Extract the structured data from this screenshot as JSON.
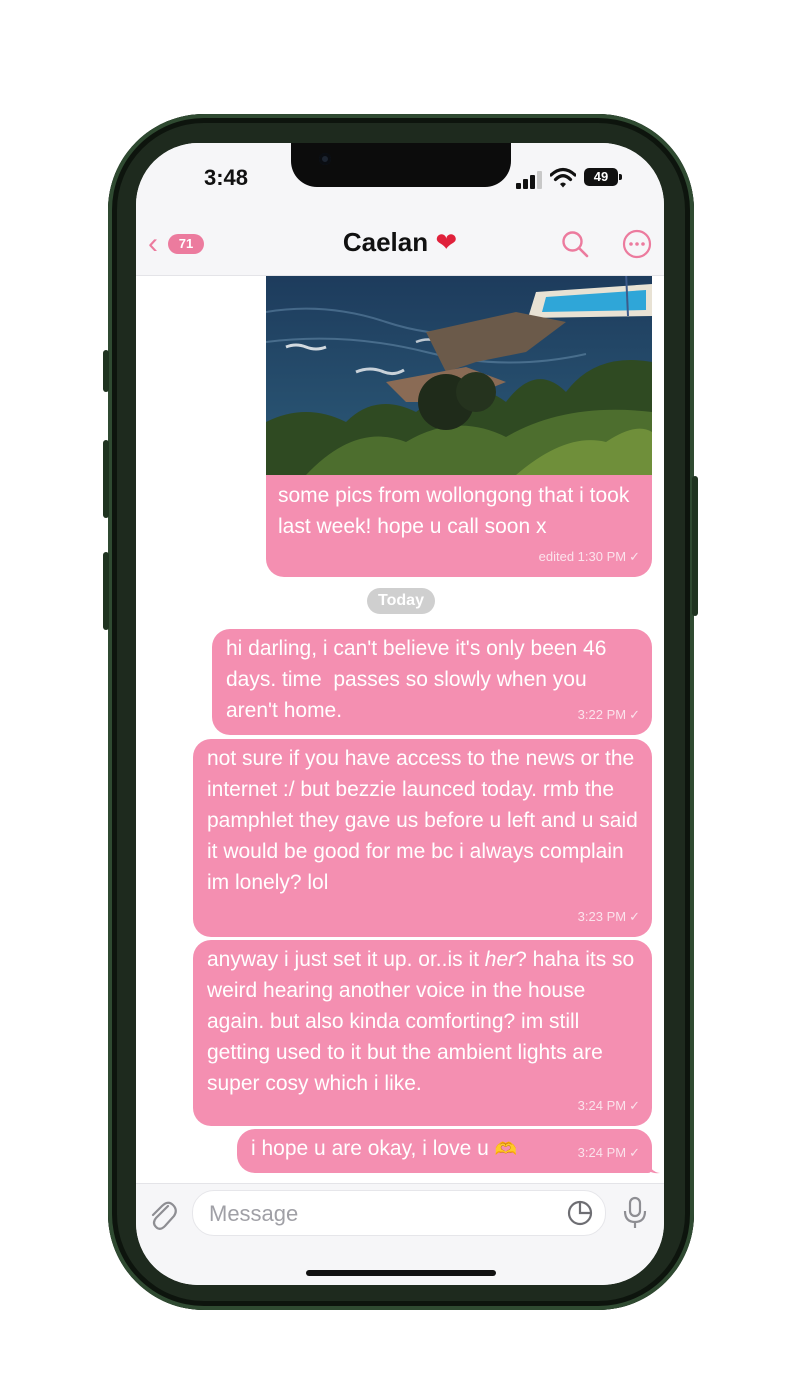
{
  "status_bar": {
    "time": "3:48",
    "battery": "49"
  },
  "header": {
    "back_count": "71",
    "contact_name": "Caelan",
    "name_emoji": "❤"
  },
  "messages": [
    {
      "type": "photo",
      "caption": "some pics from wollongong that i took last week! hope u call soon x",
      "meta": "edited 1:30 PM"
    },
    {
      "type": "date_separator",
      "label": "Today"
    },
    {
      "type": "text",
      "text": "hi darling, i can't believe it's only been 46 days. time  passes so slowly when you aren't home.",
      "time": "3:22 PM"
    },
    {
      "type": "text",
      "text": "not sure if you have access to the news or the internet :/ but bezzie launced today. rmb the pamphlet they gave us before u left and u said it would be good for me bc i always complain im lonely? lol",
      "time": "3:23 PM"
    },
    {
      "type": "text",
      "text_before": "anyway i just set it up. or..is it ",
      "text_italic": "her",
      "text_after": "? haha its so weird hearing another voice in the house again. but also kinda comforting? im still getting used to it but the ambient lights are super cosy which i like.",
      "time": "3:24 PM"
    },
    {
      "type": "text",
      "text": "i hope u are okay, i love u",
      "emoji": "🫶",
      "time": "3:24 PM"
    }
  ],
  "input": {
    "placeholder": "Message"
  },
  "colors": {
    "bubble": "#f48fb1",
    "accent": "#ec7b9e",
    "heart": "#e0213b"
  },
  "icons": [
    "back-chevron-icon",
    "search-icon",
    "more-icon",
    "attach-icon",
    "sticker-icon",
    "mic-icon",
    "signal-icon",
    "wifi-icon",
    "battery-icon",
    "read-check-icon"
  ]
}
